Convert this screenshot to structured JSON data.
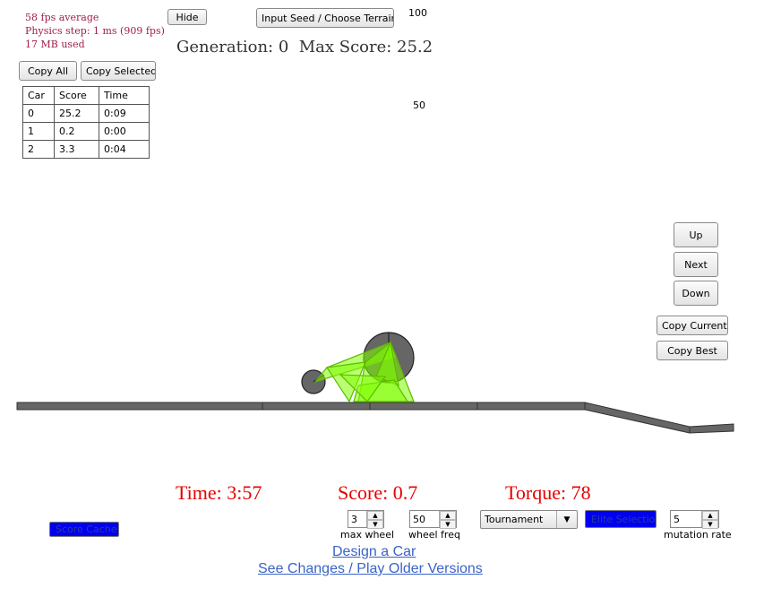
{
  "stats": {
    "fps": "58 fps average",
    "physics": "Physics step: 1 ms (909 fps)",
    "memory": "17 MB used"
  },
  "buttons": {
    "hide": "Hide",
    "input_seed": "Input Seed / Choose Terrain",
    "copy_all": "Copy All",
    "copy_selected": "Copy Selected",
    "up": "Up",
    "next": "Next",
    "down": "Down",
    "copy_current": "Copy Current",
    "copy_best": "Copy Best",
    "score_cache": "Score Cache",
    "elite_selection": "Elite Selection"
  },
  "header": {
    "generation": "Generation: 0  Max Score: 25.2"
  },
  "graph": {
    "label_100": "100",
    "label_50": "50"
  },
  "table": {
    "columns": [
      "Car",
      "Score",
      "Time"
    ],
    "rows": [
      [
        "0",
        "25.2",
        "0:09"
      ],
      [
        "1",
        "0.2",
        "0:00"
      ],
      [
        "2",
        "3.3",
        "0:04"
      ]
    ]
  },
  "readouts": {
    "time": "Time: 3:57",
    "score": "Score: 0.7",
    "torque": "Torque: 78"
  },
  "controls": {
    "max_wheel_value": "3",
    "max_wheel_label": "max wheel",
    "wheel_freq_value": "50",
    "wheel_freq_label": "wheel freq",
    "selection_value": "Tournament",
    "mutation_value": "5",
    "mutation_label": "mutation rate"
  },
  "links": {
    "design": "Design a Car",
    "changes": "See Changes / Play Older Versions"
  },
  "colors": {
    "car_body": "#7fff00",
    "wheel": "#666666",
    "track": "#555555",
    "readout": "#e80000",
    "stats": "#a0204a",
    "link": "#3a63c8"
  }
}
